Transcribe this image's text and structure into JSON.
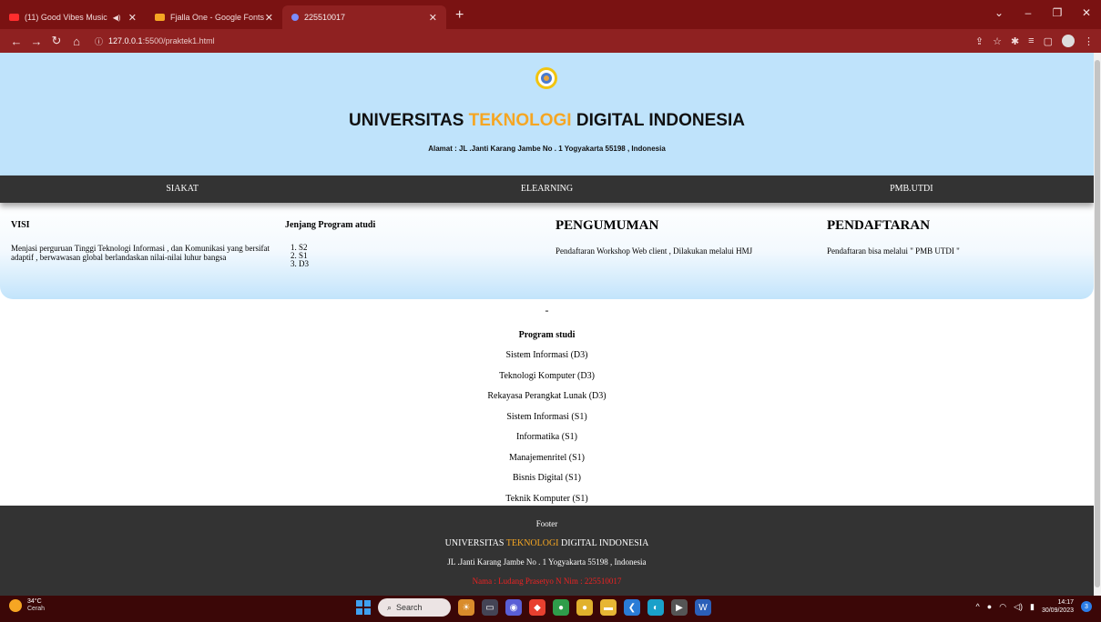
{
  "browser": {
    "tabs": [
      {
        "label": "(11) Good Vibes Music",
        "color": "#ff3b30"
      },
      {
        "label": "Fjalla One - Google Fonts",
        "color": "#f5a623"
      },
      {
        "label": "225510017",
        "color": "#7b8cff"
      }
    ],
    "new_tab": "+",
    "url_host": "127.0.0.1",
    "url_rest": ":5500/praktek1.html",
    "win_minimize": "–",
    "win_maximize": "❐",
    "win_close": "✕",
    "tab_dropdown": "⌄"
  },
  "header": {
    "title_part1": "UNIVERSITAS ",
    "title_part2": "TEKNOLOGI",
    "title_part3": " DIGITAL INDONESIA",
    "address": "Alamat : JL .Janti Karang Jambe No . 1 Yogyakarta 55198 , Indonesia"
  },
  "nav": {
    "items": [
      "SIAKAT",
      "ELEARNING",
      "PMB.UTDI"
    ]
  },
  "visi": {
    "title": "VISI",
    "text": "Menjasi perguruan Tinggi Teknologi Informasi , dan Komunikasi yang bersifat adaptif , berwawasan global berlandaskan nilai-nilai luhur bangsa"
  },
  "jenjang": {
    "title": "Jenjang Program atudi",
    "items": [
      "1. S2",
      "2. S1",
      "3. D3"
    ]
  },
  "pengumuman": {
    "title": "PENGUMUMAN",
    "text": "Pendaftaran Workshop Web client , Dilakukan melalui HMJ"
  },
  "pendaftaran": {
    "title": "PENDAFTARAN",
    "text": "Pendaftaran bisa melalui \" PMB UTDI \""
  },
  "program_studi": {
    "dash": "-",
    "title": "Program studi",
    "items": [
      "Sistem Informasi (D3)",
      "Teknologi Komputer (D3)",
      "Rekayasa Perangkat Lunak (D3)",
      "Sistem Informasi (S1)",
      "Informatika (S1)",
      "Manajemenritel (S1)",
      "Bisnis Digital (S1)",
      "Teknik Komputer (S1)"
    ]
  },
  "footer": {
    "label": "Footer",
    "name_part1": "UNIVERSITAS ",
    "name_part2": "TEKNOLOGI",
    "name_part3": " DIGITAL INDONESIA",
    "address": "JL .Janti Karang Jambe No . 1 Yogyakarta 55198 , Indonesia",
    "credit": "Nama : Ludang Prasetyo N Nim : 225510017"
  },
  "taskbar": {
    "temp": "34°C",
    "condition": "Cerah",
    "search": "Search",
    "time": "14:17",
    "date": "30/09/2023",
    "notifications": "3"
  }
}
